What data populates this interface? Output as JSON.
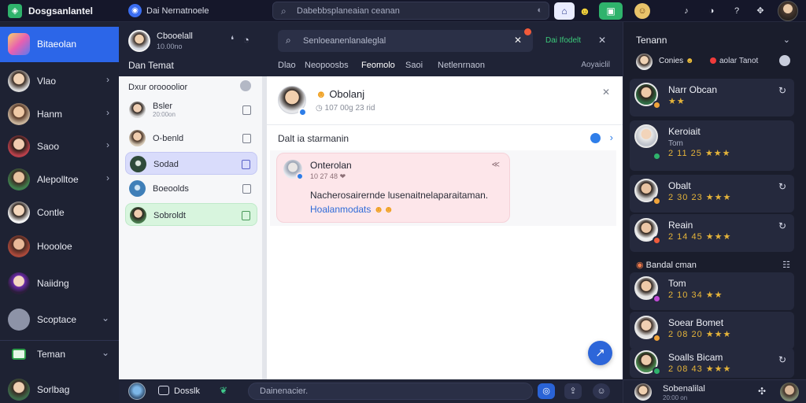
{
  "topbar": {
    "app_title": "Dosgsanlantel",
    "workspace": "Dai Nernatnoele",
    "search_placeholder": "Dabebbsplaneaian ceanan",
    "icons": [
      "home-icon",
      "emoji-icon",
      "video-call-icon",
      "profile-icon",
      "notification-icon",
      "theme-icon",
      "help-icon",
      "grid-icon"
    ]
  },
  "sidebar": {
    "items": [
      {
        "label": "Bitaeolan",
        "active": true,
        "chevron": false
      },
      {
        "label": "Vlao",
        "chevron": true
      },
      {
        "label": "Hanm",
        "chevron": true
      },
      {
        "label": "Saoo",
        "chevron": true
      },
      {
        "label": "Alepolltoe",
        "chevron": true
      },
      {
        "label": "Contle",
        "chevron": false
      },
      {
        "label": "Hoooloe",
        "chevron": false
      },
      {
        "label": "Naiidng",
        "chevron": false
      },
      {
        "label": "Scoptace",
        "chevron": true
      },
      {
        "label": "Teman",
        "chevron": true
      },
      {
        "label": "Sorlbag",
        "chevron": false
      }
    ]
  },
  "chat_list": {
    "user_name": "Cbooelall",
    "user_status": "10.00no",
    "title": "Dan Temat",
    "subheader": "Dxur oroooolior",
    "rows": [
      {
        "name": "Bsler",
        "sub": "20:00on"
      },
      {
        "name": "O-benld",
        "sub": ""
      },
      {
        "name": "Sodad",
        "sub": ""
      },
      {
        "name": "Boeoolds",
        "sub": ""
      },
      {
        "name": "Sobroldt",
        "sub": ""
      }
    ]
  },
  "chat": {
    "search_placeholder": "Senloeanenlanaleglal",
    "link_label": "Dai Ifodelt",
    "tabs": [
      "Dlao",
      "Neopoosbs",
      "Feomolo",
      "Saoi",
      "Netlenrnaon"
    ],
    "tabs_right": "Aoyaiclil",
    "contact_name": "Obolanj",
    "contact_time": "107 00g 23 rid",
    "date_label": "Dalt ia starmanin",
    "message": {
      "sender": "Onterolan",
      "time": "10 27 48",
      "body": "Nacherosairernde lusenaitnelaparaitaman.",
      "link": "Hoalanmodats"
    }
  },
  "composer": {
    "button_label": "Dosslk",
    "placeholder": "Dainenacier."
  },
  "right_panel": {
    "title": "Tenann",
    "me_label": "Conies",
    "me_status": "aolar Tanot",
    "people": [
      {
        "name": "Narr Obcan",
        "sub": "",
        "stars": "★★",
        "status_color": "#f0a33a"
      },
      {
        "name": "Keroiait",
        "sub": "Tom",
        "stars": "2 11 25 ★★★",
        "status_color": "#2fb36c"
      },
      {
        "name": "Obalt",
        "sub": "",
        "stars": "2 30 23 ★★★",
        "status_color": "#f0a33a"
      },
      {
        "name": "Reain",
        "sub": "",
        "stars": "2 14 45 ★★★",
        "status_color": "#ef5b3b"
      }
    ],
    "section_title": "Bandal cman",
    "people2": [
      {
        "name": "Tom",
        "sub": "",
        "stars": "2 10 34 ★★",
        "status_color": "#c14bd6"
      },
      {
        "name": "Soear Bomet",
        "sub": "",
        "stars": "2 08 20 ★★★",
        "status_color": "#f0a33a"
      },
      {
        "name": "Soalls Bicam",
        "sub": "",
        "stars": "2 08 43 ★★★",
        "status_color": "#2fb36c"
      }
    ],
    "footer_name": "Sobenalilal",
    "footer_sub": "20:00 on"
  },
  "colors": {
    "accent": "#2c66e8",
    "dark_bg": "#1f2336",
    "message_bg": "#fde6ea",
    "selected_row": "#d9dcfb",
    "green_row": "#d8f5de"
  }
}
